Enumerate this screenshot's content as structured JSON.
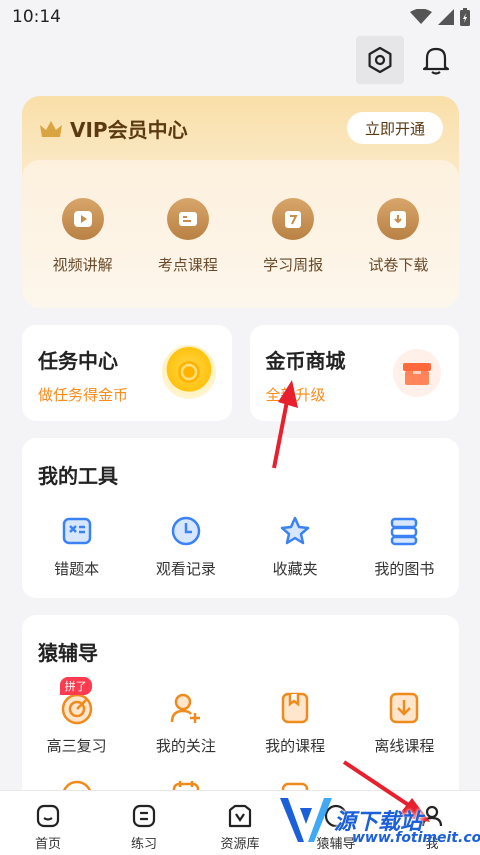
{
  "status_bar": {
    "time": "10:14"
  },
  "vip": {
    "title": "VIP会员中心",
    "open_button": "立即开通",
    "items": [
      {
        "label": "视频讲解",
        "icon": "play-icon"
      },
      {
        "label": "考点课程",
        "icon": "book-icon"
      },
      {
        "label": "学习周报",
        "icon": "calendar-7-icon"
      },
      {
        "label": "试卷下载",
        "icon": "download-icon"
      }
    ]
  },
  "task": {
    "title": "任务中心",
    "subtitle": "做任务得金币"
  },
  "shop": {
    "title": "金币商城",
    "subtitle": "全新升级"
  },
  "tools": {
    "title": "我的工具",
    "items": [
      {
        "label": "错题本",
        "icon": "wrong-book-icon"
      },
      {
        "label": "观看记录",
        "icon": "clock-icon"
      },
      {
        "label": "收藏夹",
        "icon": "star-icon"
      },
      {
        "label": "我的图书",
        "icon": "books-icon"
      }
    ]
  },
  "tutor": {
    "title": "猿辅导",
    "items": [
      {
        "label": "高三复习",
        "icon": "target-icon",
        "badge": "拼了"
      },
      {
        "label": "我的关注",
        "icon": "follow-user-icon"
      },
      {
        "label": "我的课程",
        "icon": "course-icon"
      },
      {
        "label": "离线课程",
        "icon": "offline-download-icon"
      }
    ]
  },
  "bottom_nav": [
    {
      "label": "首页",
      "icon": "home-icon"
    },
    {
      "label": "练习",
      "icon": "practice-icon"
    },
    {
      "label": "资源库",
      "icon": "resource-icon"
    },
    {
      "label": "猿辅导",
      "icon": "tutor-icon"
    },
    {
      "label": "我",
      "icon": "me-icon"
    }
  ],
  "watermark": {
    "text": "源下载站",
    "url": "www.fotimeit.com"
  },
  "colors": {
    "accent": "#ff8a1a",
    "vip_brown": "#5b3a12",
    "blue_icon": "#3b82f6",
    "orange_icon": "#f08a1c"
  }
}
